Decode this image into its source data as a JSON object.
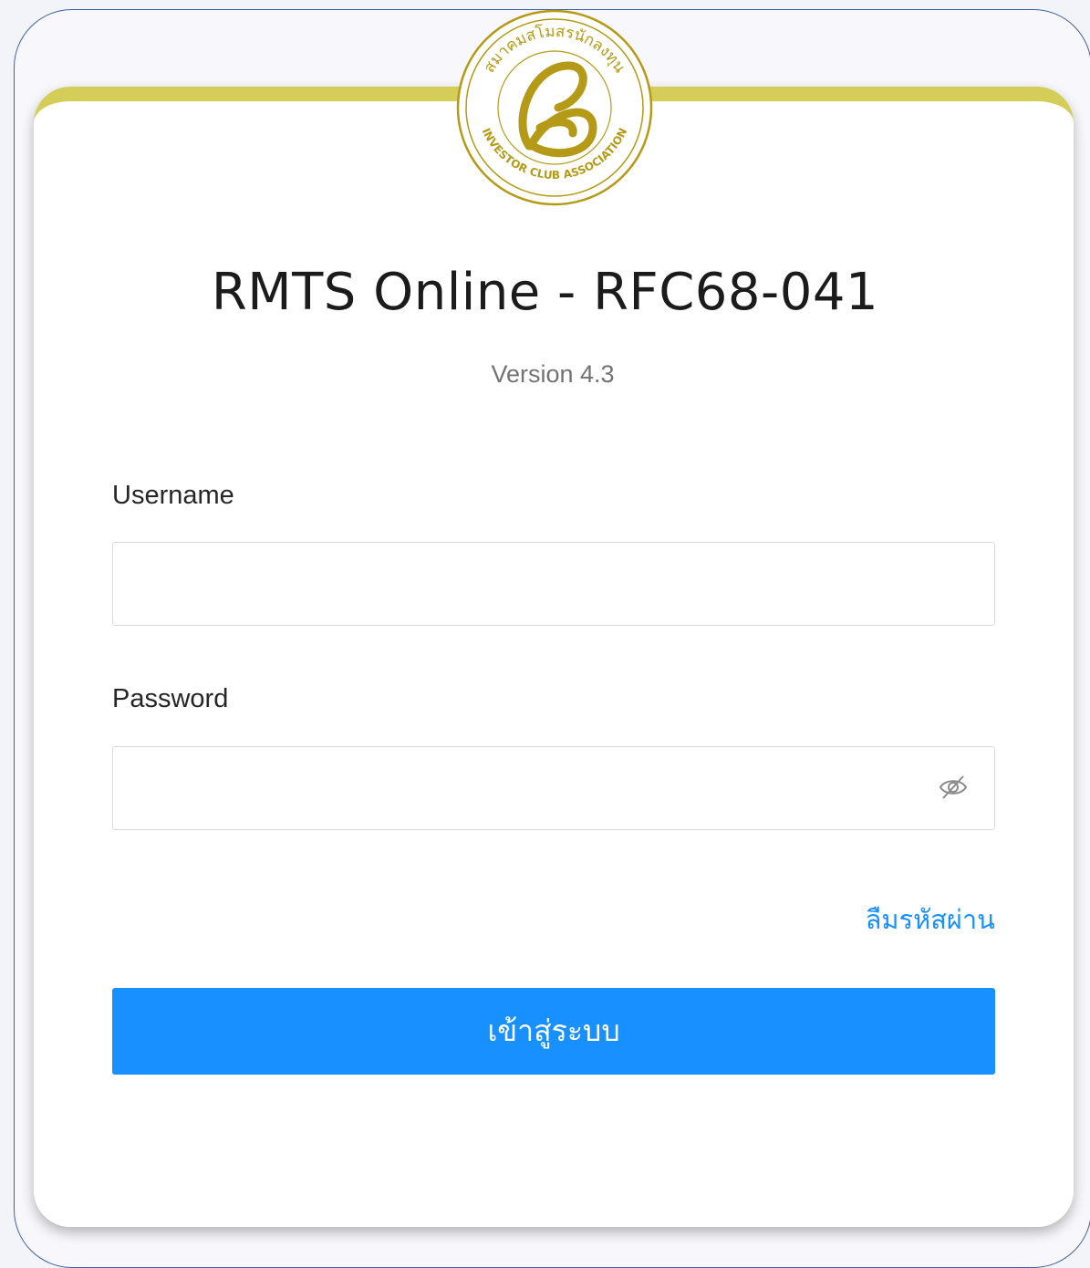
{
  "logo": {
    "icon": "investor-club-association-seal",
    "ring_text_top": "สมาคมสโมสรนักลงทุน",
    "ring_text_bottom": "INVESTOR CLUB ASSOCIATION",
    "color": "#b59a17"
  },
  "header": {
    "title": "RMTS Online - RFC68-041",
    "version": "Version 4.3"
  },
  "form": {
    "username_label": "Username",
    "username_value": "",
    "username_placeholder": "",
    "password_label": "Password",
    "password_value": "",
    "password_placeholder": "",
    "password_toggle_icon": "eye-invisible-icon",
    "forgot_password_label": "ลืมรหัสผ่าน",
    "submit_label": "เข้าสู่ระบบ"
  },
  "colors": {
    "accent": "#1890ff",
    "card_top_border": "#d4cd57",
    "frame_border": "#3d5ea8"
  }
}
